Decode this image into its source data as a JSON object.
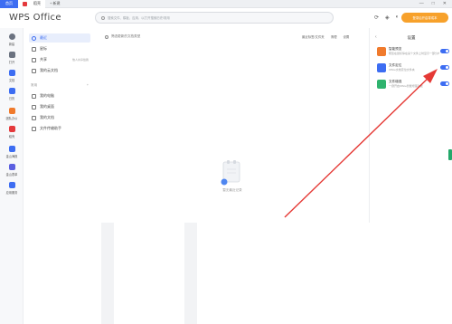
{
  "tabs": {
    "home": "首页",
    "doc": "稻壳",
    "new": "+ 新建"
  },
  "window_controls": {
    "minimize": "—",
    "maximize": "□",
    "close": "✕"
  },
  "header": {
    "logo": "WPS Office",
    "search_placeholder": "搜索文件、模板、应用，以打开搜索历史/常用",
    "upgrade_label": "登录后开启零成本"
  },
  "rail": {
    "items": [
      {
        "label": "新建",
        "icon": "plus-icon"
      },
      {
        "label": "打开",
        "icon": "folder-icon"
      },
      {
        "label": "文档",
        "icon": "document-icon",
        "active": true
      },
      {
        "label": "日历",
        "icon": "calendar-icon"
      },
      {
        "label": "团队办公",
        "icon": "team-icon"
      },
      {
        "label": "稻壳",
        "icon": "docer-icon"
      },
      {
        "label": "金山海报",
        "icon": "poster-icon"
      },
      {
        "label": "金山表单",
        "icon": "form-icon"
      },
      {
        "label": "应用服务",
        "icon": "apps-icon"
      }
    ]
  },
  "nav": {
    "items": [
      {
        "label": "最近",
        "icon": "clock-icon",
        "active": true
      },
      {
        "label": "星标",
        "icon": "star-icon"
      },
      {
        "label": "共享",
        "icon": "share-icon",
        "extra": "他人共享给我"
      },
      {
        "label": "我的云文档",
        "icon": "cloud-icon"
      }
    ],
    "section": "常用",
    "section_action": "+",
    "quick": [
      {
        "label": "我的电脑",
        "icon": "computer-icon"
      },
      {
        "label": "我的桌面",
        "icon": "desktop-icon"
      },
      {
        "label": "我的文档",
        "icon": "folder-icon"
      },
      {
        "label": "文件传输助手",
        "icon": "transfer-icon"
      }
    ]
  },
  "main": {
    "filter": "筛选更新的文档类型",
    "tools": [
      "最近标签/文件夹",
      "清理",
      "设置"
    ],
    "empty_text": "暂无最近记录"
  },
  "panel": {
    "back": "‹",
    "title": "设置",
    "rows": [
      {
        "title": "智能预览",
        "desc": "帮您在鼠标停在某个文件上时显示一部分内容",
        "color": "#f07a2c",
        "enabled": true
      },
      {
        "title": "文件定位",
        "desc": "Office文档定位文件夹",
        "color": "#3d6df2",
        "enabled": true
      },
      {
        "title": "文件增强",
        "desc": "一键开启Office智能增强功能",
        "color": "#2fb36e",
        "enabled": true
      }
    ]
  },
  "colors": {
    "accent": "#3d6df2",
    "upgrade": "#f7a12b",
    "annotation": "#e53935"
  }
}
